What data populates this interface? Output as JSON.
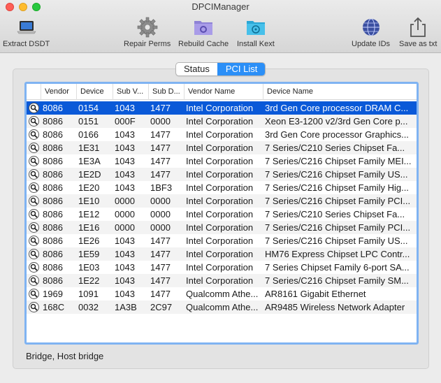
{
  "window": {
    "title": "DPCIManager"
  },
  "toolbar": {
    "extract_dsdt": "Extract DSDT",
    "repair_perms": "Repair Perms",
    "rebuild_cache": "Rebuild Cache",
    "install_kext": "Install Kext",
    "update_ids": "Update IDs",
    "save_as_txt": "Save as txt"
  },
  "tabs": [
    {
      "label": "Status",
      "active": false
    },
    {
      "label": "PCI List",
      "active": true
    }
  ],
  "table": {
    "columns": [
      "Vendor",
      "Device",
      "Sub V...",
      "Sub D...",
      "Vendor Name",
      "Device Name"
    ],
    "rows": [
      {
        "vendor": "8086",
        "device": "0154",
        "subv": "1043",
        "subd": "1477",
        "vendor_name": "Intel Corporation",
        "device_name": "3rd Gen Core processor DRAM C...",
        "selected": true
      },
      {
        "vendor": "8086",
        "device": "0151",
        "subv": "000F",
        "subd": "0000",
        "vendor_name": "Intel Corporation",
        "device_name": "Xeon E3-1200 v2/3rd Gen Core p..."
      },
      {
        "vendor": "8086",
        "device": "0166",
        "subv": "1043",
        "subd": "1477",
        "vendor_name": "Intel Corporation",
        "device_name": "3rd Gen Core processor Graphics..."
      },
      {
        "vendor": "8086",
        "device": "1E31",
        "subv": "1043",
        "subd": "1477",
        "vendor_name": "Intel Corporation",
        "device_name": "7 Series/C210 Series Chipset Fa..."
      },
      {
        "vendor": "8086",
        "device": "1E3A",
        "subv": "1043",
        "subd": "1477",
        "vendor_name": "Intel Corporation",
        "device_name": "7 Series/C216 Chipset Family MEI..."
      },
      {
        "vendor": "8086",
        "device": "1E2D",
        "subv": "1043",
        "subd": "1477",
        "vendor_name": "Intel Corporation",
        "device_name": "7 Series/C216 Chipset Family US..."
      },
      {
        "vendor": "8086",
        "device": "1E20",
        "subv": "1043",
        "subd": "1BF3",
        "vendor_name": "Intel Corporation",
        "device_name": "7 Series/C216 Chipset Family Hig..."
      },
      {
        "vendor": "8086",
        "device": "1E10",
        "subv": "0000",
        "subd": "0000",
        "vendor_name": "Intel Corporation",
        "device_name": "7 Series/C216 Chipset Family PCI..."
      },
      {
        "vendor": "8086",
        "device": "1E12",
        "subv": "0000",
        "subd": "0000",
        "vendor_name": "Intel Corporation",
        "device_name": "7 Series/C210 Series Chipset Fa..."
      },
      {
        "vendor": "8086",
        "device": "1E16",
        "subv": "0000",
        "subd": "0000",
        "vendor_name": "Intel Corporation",
        "device_name": "7 Series/C216 Chipset Family PCI..."
      },
      {
        "vendor": "8086",
        "device": "1E26",
        "subv": "1043",
        "subd": "1477",
        "vendor_name": "Intel Corporation",
        "device_name": "7 Series/C216 Chipset Family US..."
      },
      {
        "vendor": "8086",
        "device": "1E59",
        "subv": "1043",
        "subd": "1477",
        "vendor_name": "Intel Corporation",
        "device_name": "HM76 Express Chipset LPC Contr..."
      },
      {
        "vendor": "8086",
        "device": "1E03",
        "subv": "1043",
        "subd": "1477",
        "vendor_name": "Intel Corporation",
        "device_name": "7 Series Chipset Family 6-port SA..."
      },
      {
        "vendor": "8086",
        "device": "1E22",
        "subv": "1043",
        "subd": "1477",
        "vendor_name": "Intel Corporation",
        "device_name": "7 Series/C216 Chipset Family SM..."
      },
      {
        "vendor": "1969",
        "device": "1091",
        "subv": "1043",
        "subd": "1477",
        "vendor_name": "Qualcomm Athe...",
        "device_name": "AR8161 Gigabit Ethernet"
      },
      {
        "vendor": "168C",
        "device": "0032",
        "subv": "1A3B",
        "subd": "2C97",
        "vendor_name": "Qualcomm Athe...",
        "device_name": "AR9485 Wireless Network Adapter"
      }
    ]
  },
  "status_text": "Bridge, Host bridge",
  "icons": {
    "extract": "laptop-icon",
    "repair": "gear-icon",
    "rebuild": "folder-gear-icon",
    "install": "folder-radiation-icon",
    "update": "globe-icon",
    "save": "share-icon",
    "row": "magnifier-icon"
  },
  "colors": {
    "selection": "#0a59d8",
    "accent": "#2b8ff7",
    "focus_ring": "#7fb3f2"
  }
}
